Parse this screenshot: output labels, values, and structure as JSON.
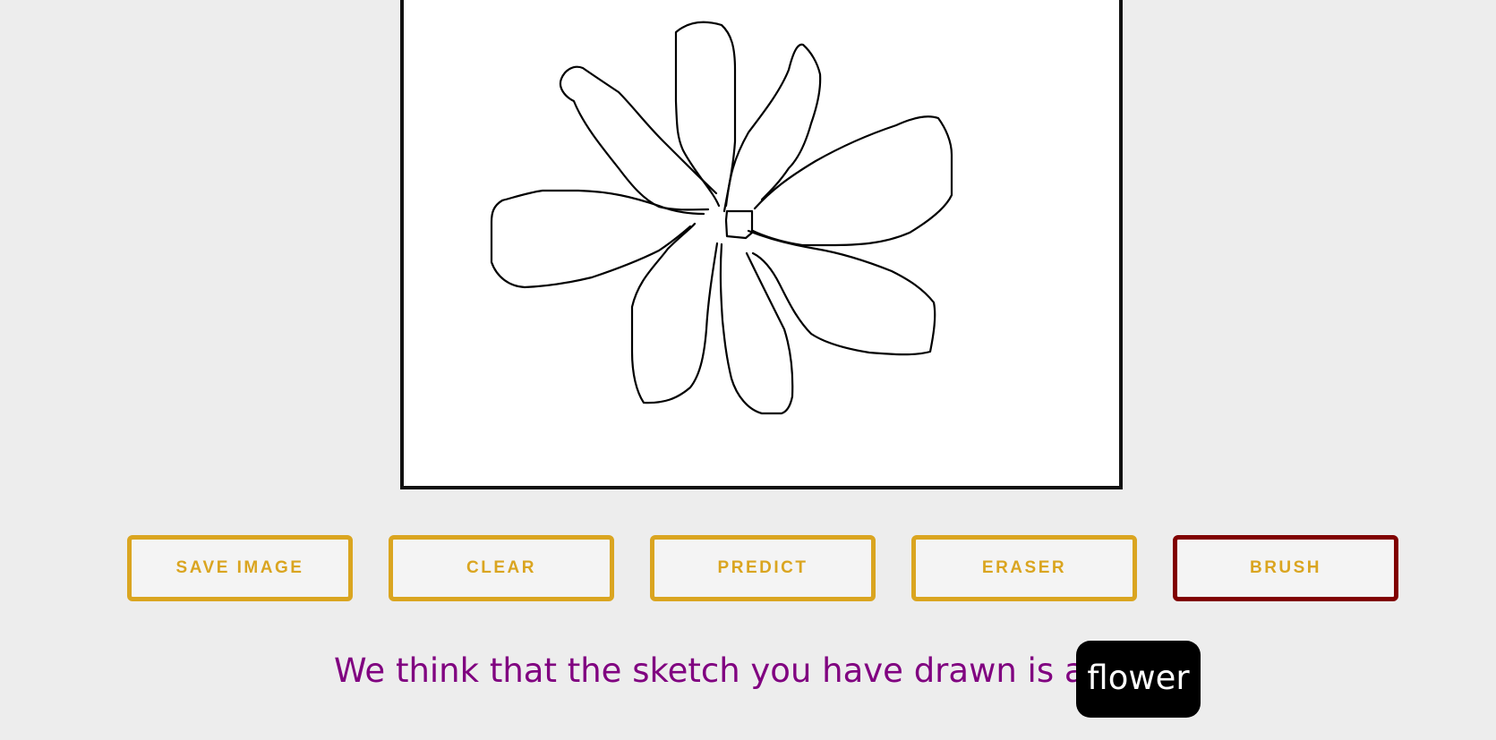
{
  "toolbar": {
    "buttons": [
      {
        "label": "SAVE IMAGE",
        "active": false
      },
      {
        "label": "CLEAR",
        "active": false
      },
      {
        "label": "PREDICT",
        "active": false
      },
      {
        "label": "ERASER",
        "active": false
      },
      {
        "label": "BRUSH",
        "active": true
      }
    ]
  },
  "result": {
    "prefix": "We think that the sketch you have drawn is a:",
    "prediction": "flower"
  },
  "colors": {
    "page_background": "#ededed",
    "canvas_background": "#ffffff",
    "button_border": "#daa520",
    "button_text": "#daa520",
    "active_button_border": "#800000",
    "result_text": "#800080",
    "badge_background": "#000000",
    "badge_text": "#ffffff"
  }
}
